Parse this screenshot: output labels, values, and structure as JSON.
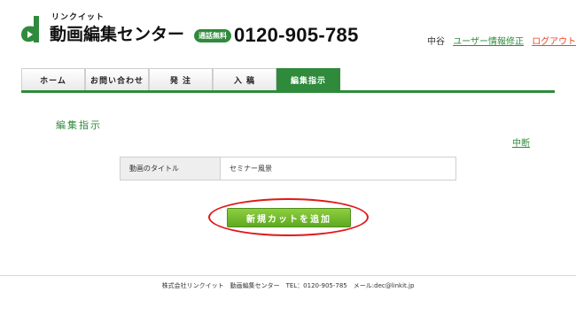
{
  "header": {
    "logo_sub": "リンクイット",
    "logo_main": "動画編集センター",
    "free_badge": "通話無料",
    "phone": "0120-905-785",
    "user_name": "中谷",
    "profile_link": "ユーザー情報修正",
    "logout_link": "ログアウト"
  },
  "nav": {
    "items": [
      {
        "label": "ホーム"
      },
      {
        "label": "お問い合わせ"
      },
      {
        "label": "発 注"
      },
      {
        "label": "入 稿"
      },
      {
        "label": "編集指示"
      }
    ],
    "active_index": 4
  },
  "main": {
    "section_title": "編集指示",
    "cancel_link": "中断",
    "form": {
      "label": "動画のタイトル",
      "value": "セミナー風景"
    },
    "add_button": "新規カットを追加"
  },
  "footer": {
    "text": "株式会社リンクイット　動画編集センター　TEL：0120-905-785　メール:dec@linkit.jp"
  },
  "colors": {
    "brand_green": "#2f8a3c",
    "button_green": "#6db52c",
    "logout_red": "#e8472a",
    "highlight_red": "#e01818"
  }
}
